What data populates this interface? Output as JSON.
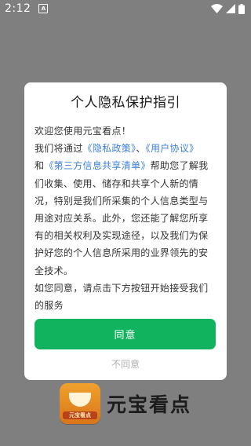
{
  "status_bar": {
    "time": "2:12",
    "notification_icon": "a-app-icon",
    "icons": [
      "wifi-icon",
      "signal-icon",
      "battery-icon"
    ]
  },
  "dialog": {
    "title": "个人隐私保护指引",
    "welcome": "欢迎您使用元宝看点！",
    "intro_text": "我们将通过",
    "privacy_policy_link": "《隐私政策》",
    "separator": "、",
    "user_agreement_link": "《用户协议》",
    "and_text": "和",
    "third_party_link": "《第三方信息共享清单》",
    "body_text": "帮助您了解我们收集、使用、储存和共享个人新的情况，特别是我们所采集的个人信息类型与用途对应关系。此外，您还能了解您所享有的相关权利及实现途径，以及我们为保护好您的个人信息所采用的业界领先的安全技术。",
    "consent_text": "如您同意，请点击下方按钮开始接受我们的服务",
    "agree_label": "同意",
    "disagree_label": "不同意"
  },
  "splash": {
    "app_name": "元宝看点",
    "logo_band_text": "元宝看点"
  },
  "colors": {
    "overlay": "#7f7f7f",
    "accent_green": "#12b35e",
    "link_blue": "#3d7fd8",
    "logo_orange": "#f0a12c"
  }
}
